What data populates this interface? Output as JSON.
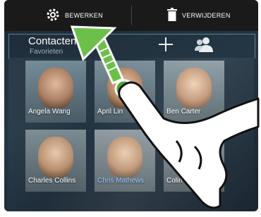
{
  "toolbar": {
    "edit_label": "BEWERKEN",
    "delete_label": "VERWIJDEREN"
  },
  "header": {
    "title": "Contacten",
    "subtitle": "Favorieten",
    "add_icon": "plus-icon",
    "group_icon": "people-icon"
  },
  "contacts": [
    {
      "name": "Angela Wang"
    },
    {
      "name": "April Lin"
    },
    {
      "name": "Ben Carter"
    },
    {
      "name": "Charles Collins"
    },
    {
      "name": "Chris Mathews"
    },
    {
      "name": "Colin"
    }
  ],
  "colors": {
    "accent_name": "#8ec5ff",
    "gesture_arrow": "#6cc04a",
    "toolbar_bg": "#1a1a1a"
  }
}
